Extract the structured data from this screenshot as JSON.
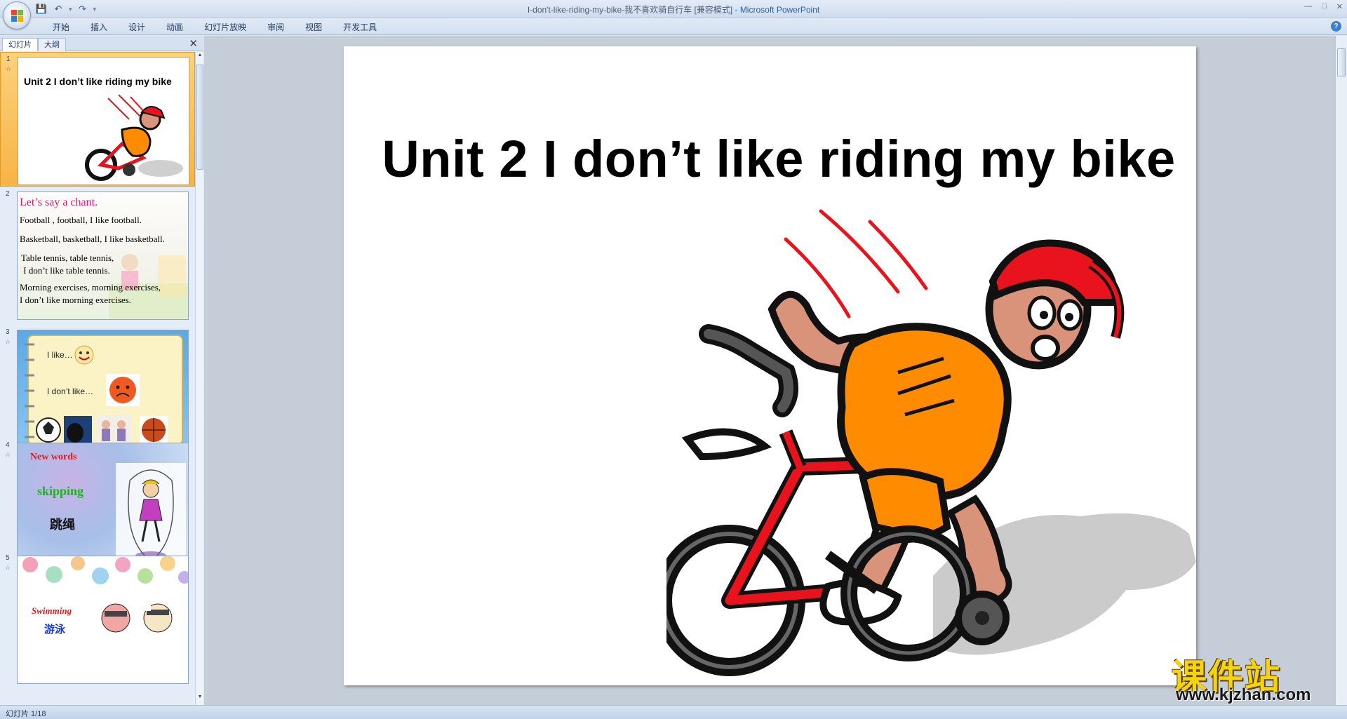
{
  "window": {
    "title": "I-don't-like-riding-my-bike-我不喜欢骑自行车 [兼容模式]",
    "title_sep": " - ",
    "app_name": "Microsoft PowerPoint"
  },
  "ribbon": {
    "tabs": [
      "开始",
      "插入",
      "设计",
      "动画",
      "幻灯片放映",
      "审阅",
      "视图",
      "开发工具"
    ]
  },
  "left_pane": {
    "tabs": [
      "幻灯片",
      "大纲"
    ],
    "thumbnails": [
      {
        "num": "1",
        "title": "Unit 2 I don’t like riding my bike"
      },
      {
        "num": "2",
        "lines": [
          "Let’s say a chant.",
          "Football , football, I like football.",
          "Basketball, basketball, I like basketball.",
          "Table tennis, table tennis,",
          " I don’t like table tennis.",
          "Morning exercises, morning exercises,",
          "I don’t like morning exercises."
        ]
      },
      {
        "num": "3",
        "lines": [
          "I like…",
          "I don’t like…"
        ]
      },
      {
        "num": "4",
        "lines": [
          "New words",
          "skipping",
          "跳绳"
        ]
      },
      {
        "num": "5",
        "lines": [
          "Swimming",
          "游泳"
        ]
      }
    ]
  },
  "slide": {
    "title": "Unit 2 I don’t like riding my bike"
  },
  "status": {
    "text": "幻灯片 1/18"
  },
  "watermark": {
    "cn": "课件站",
    "url": "www.kjzhan.com"
  },
  "colors": {
    "shirt": "#ff8c00",
    "bike": "#e8131c",
    "cap": "#e8131c",
    "selected_thumb": "#f7b447",
    "app_name": "#2f5fa5"
  }
}
